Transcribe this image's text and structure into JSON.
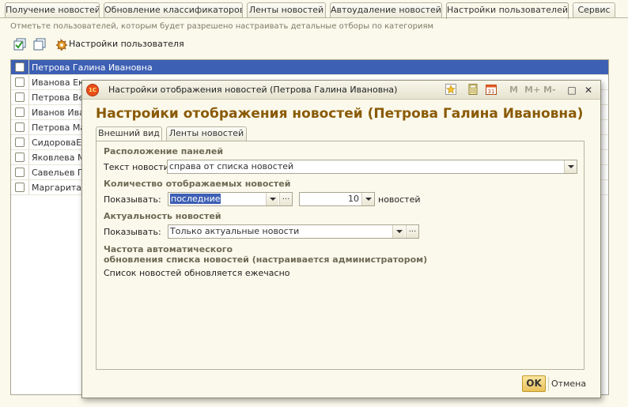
{
  "top_tabs": [
    {
      "label": "Получение новостей",
      "active": false
    },
    {
      "label": "Обновление классификаторов",
      "active": false
    },
    {
      "label": "Ленты новостей",
      "active": false
    },
    {
      "label": "Автоудаление новостей",
      "active": false
    },
    {
      "label": "Настройки пользователей",
      "active": true
    },
    {
      "label": "Сервис",
      "active": false
    }
  ],
  "hint": "Отметьте пользователей, которым будет разрешено настраивать детальные отборы по категориям",
  "toolbar": {
    "check_all_icon": "check-all-icon",
    "uncheck_all_icon": "uncheck-all-icon",
    "settings_icon": "gear-icon",
    "settings_label": "Настройки пользователя"
  },
  "users": [
    {
      "name": "Петрова Галина Ивановна",
      "selected": true
    },
    {
      "name": "Иванова Ека...",
      "selected": false
    },
    {
      "name": "Петрова Вер...",
      "selected": false
    },
    {
      "name": "Иванов Иван...",
      "selected": false
    },
    {
      "name": "Петрова Мар...",
      "selected": false
    },
    {
      "name": "СидороваЕИ...",
      "selected": false
    },
    {
      "name": "Яковлева М...",
      "selected": false
    },
    {
      "name": "Савельев Пе...",
      "selected": false
    },
    {
      "name": "Маргарита С...",
      "selected": false
    }
  ],
  "dialog": {
    "window_title": "Настройки отображения новостей (Петрова Галина Ивановна)",
    "logo_text": "1С",
    "heading": "Настройки отображения новостей (Петрова Галина Ивановна)",
    "titlebar_buttons": {
      "m": "M",
      "mplus": "M+",
      "mminus": "M-",
      "maximize": "□",
      "close": "✕"
    },
    "tabs": [
      {
        "label": "Внешний вид",
        "active": true
      },
      {
        "label": "Ленты новостей",
        "active": false
      }
    ],
    "panel_layout": {
      "title": "Расположение панелей",
      "news_text_label": "Текст новости:",
      "news_text_value": "справа от списка новостей"
    },
    "news_count": {
      "title": "Количество отображаемых новостей",
      "show_label": "Показывать:",
      "mode_value": "последние",
      "count_value": "10",
      "unit": "новостей"
    },
    "relevance": {
      "title": "Актуальность новостей",
      "show_label": "Показывать:",
      "value": "Только актуальные новости"
    },
    "auto_update": {
      "title_line1": "Частота автоматического",
      "title_line2": "обновления списка новостей (настраивается администратором)",
      "info": "Список новостей обновляется ежечасно"
    },
    "ok_label": "OK",
    "cancel_label": "Отмена"
  },
  "colors": {
    "accent": "#8a5a05",
    "selection": "#3d5fb4",
    "background": "#fbf9ec"
  }
}
